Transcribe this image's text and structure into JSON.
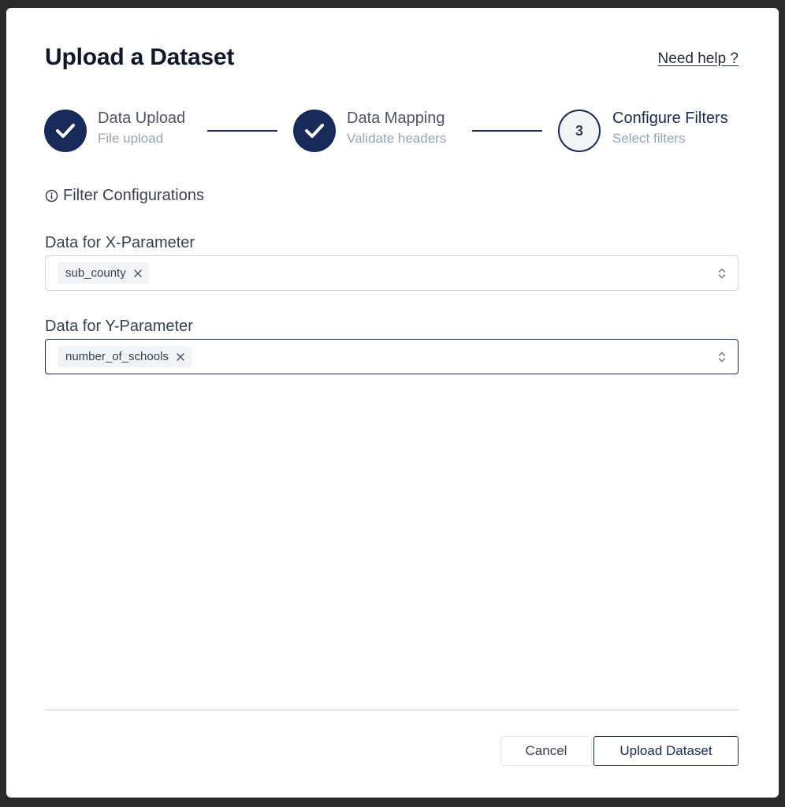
{
  "modal": {
    "title": "Upload a Dataset",
    "help_link": "Need help ?"
  },
  "stepper": {
    "steps": [
      {
        "title": "Data Upload",
        "subtitle": "File upload",
        "status": "completed"
      },
      {
        "title": "Data Mapping",
        "subtitle": "Validate headers",
        "status": "completed"
      },
      {
        "title": "Configure Filters",
        "subtitle": "Select filters",
        "status": "current",
        "number": "3"
      }
    ]
  },
  "filters": {
    "heading": "Filter Configurations",
    "heading_icon": "info-icon",
    "x_param": {
      "label": "Data for X-Parameter",
      "selected": [
        "sub_county"
      ]
    },
    "y_param": {
      "label": "Data for Y-Parameter",
      "selected": [
        "number_of_schools"
      ]
    }
  },
  "footer": {
    "cancel_label": "Cancel",
    "upload_label": "Upload Dataset"
  },
  "colors": {
    "primary": "#172a5a",
    "text": "#374151",
    "muted": "#9ca3af"
  }
}
